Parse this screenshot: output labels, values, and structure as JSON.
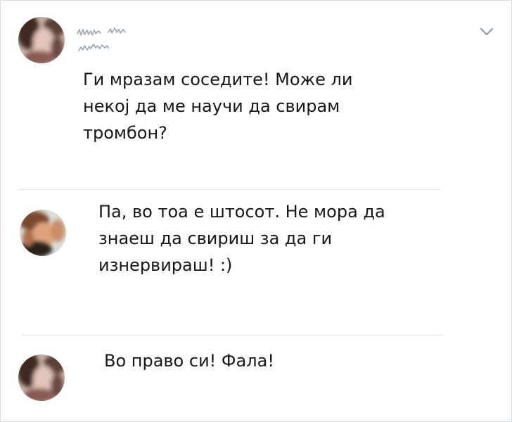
{
  "thread": {
    "original_tweet": {
      "text": "Ги мразам соседите! Може ли\nнекој да ме научи да свирам\nтромбон?"
    },
    "reply_1": {
      "text": "Па, во тоа е штосот. Не мора да\nзнаеш да свириш за да ги\nизнервираш! :)"
    },
    "reply_2": {
      "text": "Во право си! Фала!"
    }
  },
  "icons": {
    "menu": "chevron-down-icon"
  },
  "colors": {
    "text": "#14171a",
    "divider": "#e1e5e8",
    "chevron": "#8899a6"
  }
}
